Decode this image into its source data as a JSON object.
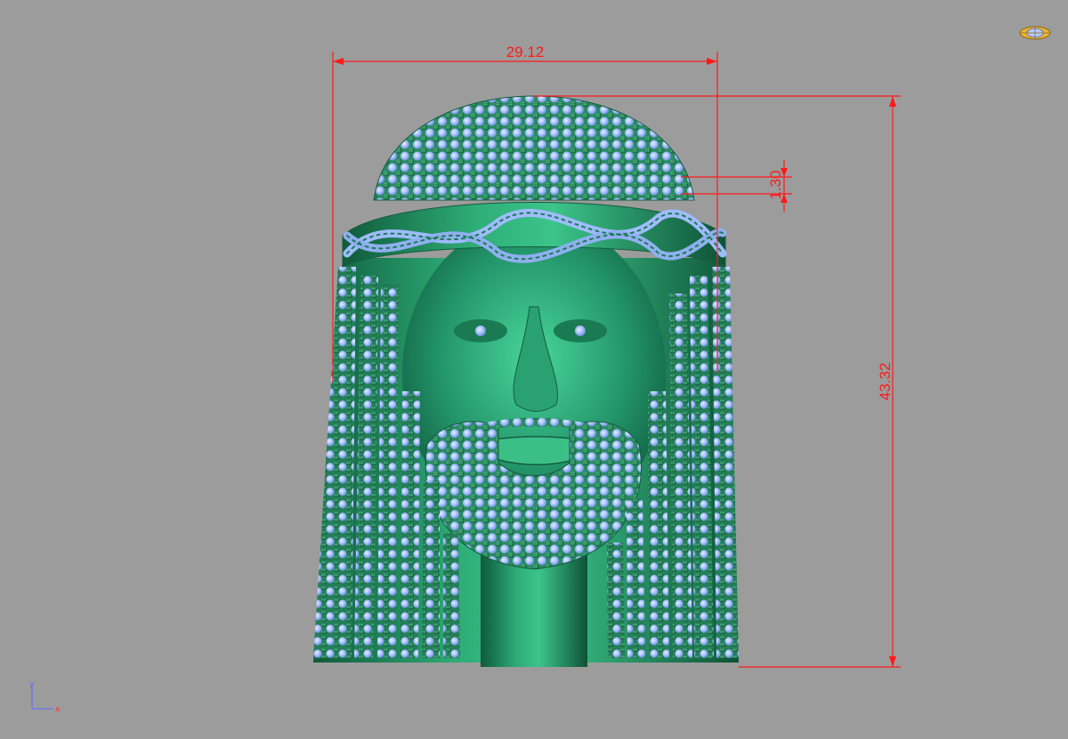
{
  "dimensions": {
    "width_label": "29.12",
    "height_label": "43.32",
    "small_label": "1.30"
  },
  "axes": {
    "y_label": "y",
    "x_label": "x"
  },
  "icons": {
    "navigation": "navigation-cube-icon",
    "axis": "axis-triad-icon"
  },
  "colors": {
    "background": "#9c9c9c",
    "dimension": "#ff1a1a",
    "model": "#1f8c5e",
    "gems": "#a8c4ff",
    "prongs": "#1d6a48"
  }
}
